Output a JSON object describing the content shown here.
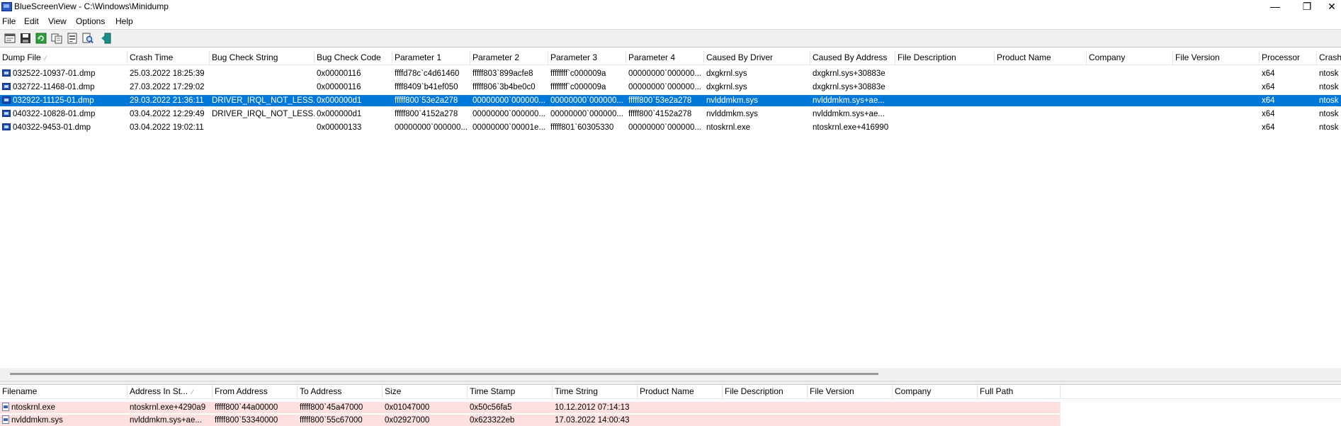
{
  "window": {
    "title": "BlueScreenView  -  C:\\Windows\\Minidump",
    "min_glyph": "—",
    "max_glyph": "❐",
    "close_glyph": "✕"
  },
  "menu": [
    "File",
    "Edit",
    "View",
    "Options",
    "Help"
  ],
  "toolbar": {
    "icons": [
      "properties-icon",
      "save-icon",
      "refresh-icon",
      "copy-icon",
      "advanced-options-icon",
      "find-icon",
      "exit-icon"
    ]
  },
  "dump_table": {
    "sort_indicator": "⁄",
    "columns": [
      "Dump File",
      "Crash Time",
      "Bug Check String",
      "Bug Check Code",
      "Parameter 1",
      "Parameter 2",
      "Parameter 3",
      "Parameter 4",
      "Caused By Driver",
      "Caused By Address",
      "File Description",
      "Product Name",
      "Company",
      "File Version",
      "Processor",
      "Crash"
    ],
    "rows": [
      [
        "032522-10937-01.dmp",
        "25.03.2022 18:25:39",
        "",
        "0x00000116",
        "ffffd78c`c4d61460",
        "fffff803`899acfe8",
        "ffffffff`c000009a",
        "00000000`000000...",
        "dxgkrnl.sys",
        "dxgkrnl.sys+30883e",
        "",
        "",
        "",
        "",
        "x64",
        "ntosk"
      ],
      [
        "032722-11468-01.dmp",
        "27.03.2022 17:29:02",
        "",
        "0x00000116",
        "ffff8409`b41ef050",
        "fffff806`3b4be0c0",
        "ffffffff`c000009a",
        "00000000`000000...",
        "dxgkrnl.sys",
        "dxgkrnl.sys+30883e",
        "",
        "",
        "",
        "",
        "x64",
        "ntosk"
      ],
      [
        "032922-11125-01.dmp",
        "29.03.2022 21:36:11",
        "DRIVER_IRQL_NOT_LESS...",
        "0x000000d1",
        "fffff800`53e2a278",
        "00000000`000000...",
        "00000000`000000...",
        "fffff800`53e2a278",
        "nvlddmkm.sys",
        "nvlddmkm.sys+ae...",
        "",
        "",
        "",
        "",
        "x64",
        "ntosk"
      ],
      [
        "040322-10828-01.dmp",
        "03.04.2022 12:29:49",
        "DRIVER_IRQL_NOT_LESS...",
        "0x000000d1",
        "fffff800`4152a278",
        "00000000`000000...",
        "00000000`000000...",
        "fffff800`4152a278",
        "nvlddmkm.sys",
        "nvlddmkm.sys+ae...",
        "",
        "",
        "",
        "",
        "x64",
        "ntosk"
      ],
      [
        "040322-9453-01.dmp",
        "03.04.2022 19:02:11",
        "",
        "0x00000133",
        "00000000`000000...",
        "00000000`00001e...",
        "fffff801`60305330",
        "00000000`000000...",
        "ntoskrnl.exe",
        "ntoskrnl.exe+416990",
        "",
        "",
        "",
        "",
        "x64",
        "ntosk"
      ]
    ],
    "selected_row": 2
  },
  "driver_table": {
    "sort_indicator": "⁄",
    "columns": [
      "Filename",
      "Address In St...",
      "From Address",
      "To Address",
      "Size",
      "Time Stamp",
      "Time String",
      "Product Name",
      "File Description",
      "File Version",
      "Company",
      "Full Path"
    ],
    "rows": [
      [
        "ntoskrnl.exe",
        "ntoskrnl.exe+4290a9",
        "fffff800`44a00000",
        "fffff800`45a47000",
        "0x01047000",
        "0x50c56fa5",
        "10.12.2012 07:14:13",
        "",
        "",
        "",
        "",
        ""
      ],
      [
        "nvlddmkm.sys",
        "nvlddmkm.sys+ae...",
        "fffff800`53340000",
        "fffff800`55c67000",
        "0x02927000",
        "0x623322eb",
        "17.03.2022 14:00:43",
        "",
        "",
        "",
        "",
        ""
      ]
    ],
    "highlight_color": "#ffe0e0"
  },
  "colors": {
    "selection": "#0078d7",
    "toolbar_bg": "#f0f0f0"
  }
}
